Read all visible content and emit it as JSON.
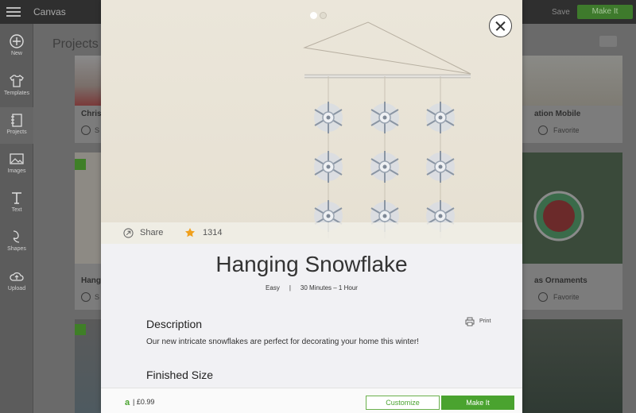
{
  "app": {
    "title": "Canvas",
    "save_label": "Save",
    "make_it_label": "Make It"
  },
  "sidebar": {
    "items": [
      {
        "label": "New",
        "icon": "plus-circle-icon"
      },
      {
        "label": "Templates",
        "icon": "shirt-icon"
      },
      {
        "label": "Projects",
        "icon": "notebook-icon"
      },
      {
        "label": "Images",
        "icon": "image-icon"
      },
      {
        "label": "Text",
        "icon": "text-icon"
      },
      {
        "label": "Shapes",
        "icon": "shapes-icon"
      },
      {
        "label": "Upload",
        "icon": "cloud-upload-icon"
      }
    ]
  },
  "background": {
    "heading": "Projects",
    "cards": [
      {
        "title": "Christ",
        "meta": "S"
      },
      {
        "title": "ation Mobile",
        "meta": "Favorite"
      },
      {
        "title": "Hangi",
        "meta": "S"
      },
      {
        "title": "as Ornaments",
        "meta": "Favorite"
      }
    ]
  },
  "modal": {
    "share_label": "Share",
    "rating_count": "1314",
    "title": "Hanging Snowflake",
    "difficulty": "Easy",
    "separator": "|",
    "duration": "30 Minutes – 1 Hour",
    "description_heading": "Description",
    "print_label": "Print",
    "description_text": "Our new intricate snowflakes are perfect for decorating your home this winter!",
    "finished_size_heading": "Finished Size",
    "access_icon": "a",
    "price": "| £0.99",
    "customize_label": "Customize",
    "make_it_label": "Make It",
    "carousel": {
      "slides": 2,
      "active": 1
    }
  },
  "colors": {
    "accent_green": "#4aa32f",
    "topbar": "#2f2f2f",
    "overlay": "#6b6b6b"
  }
}
